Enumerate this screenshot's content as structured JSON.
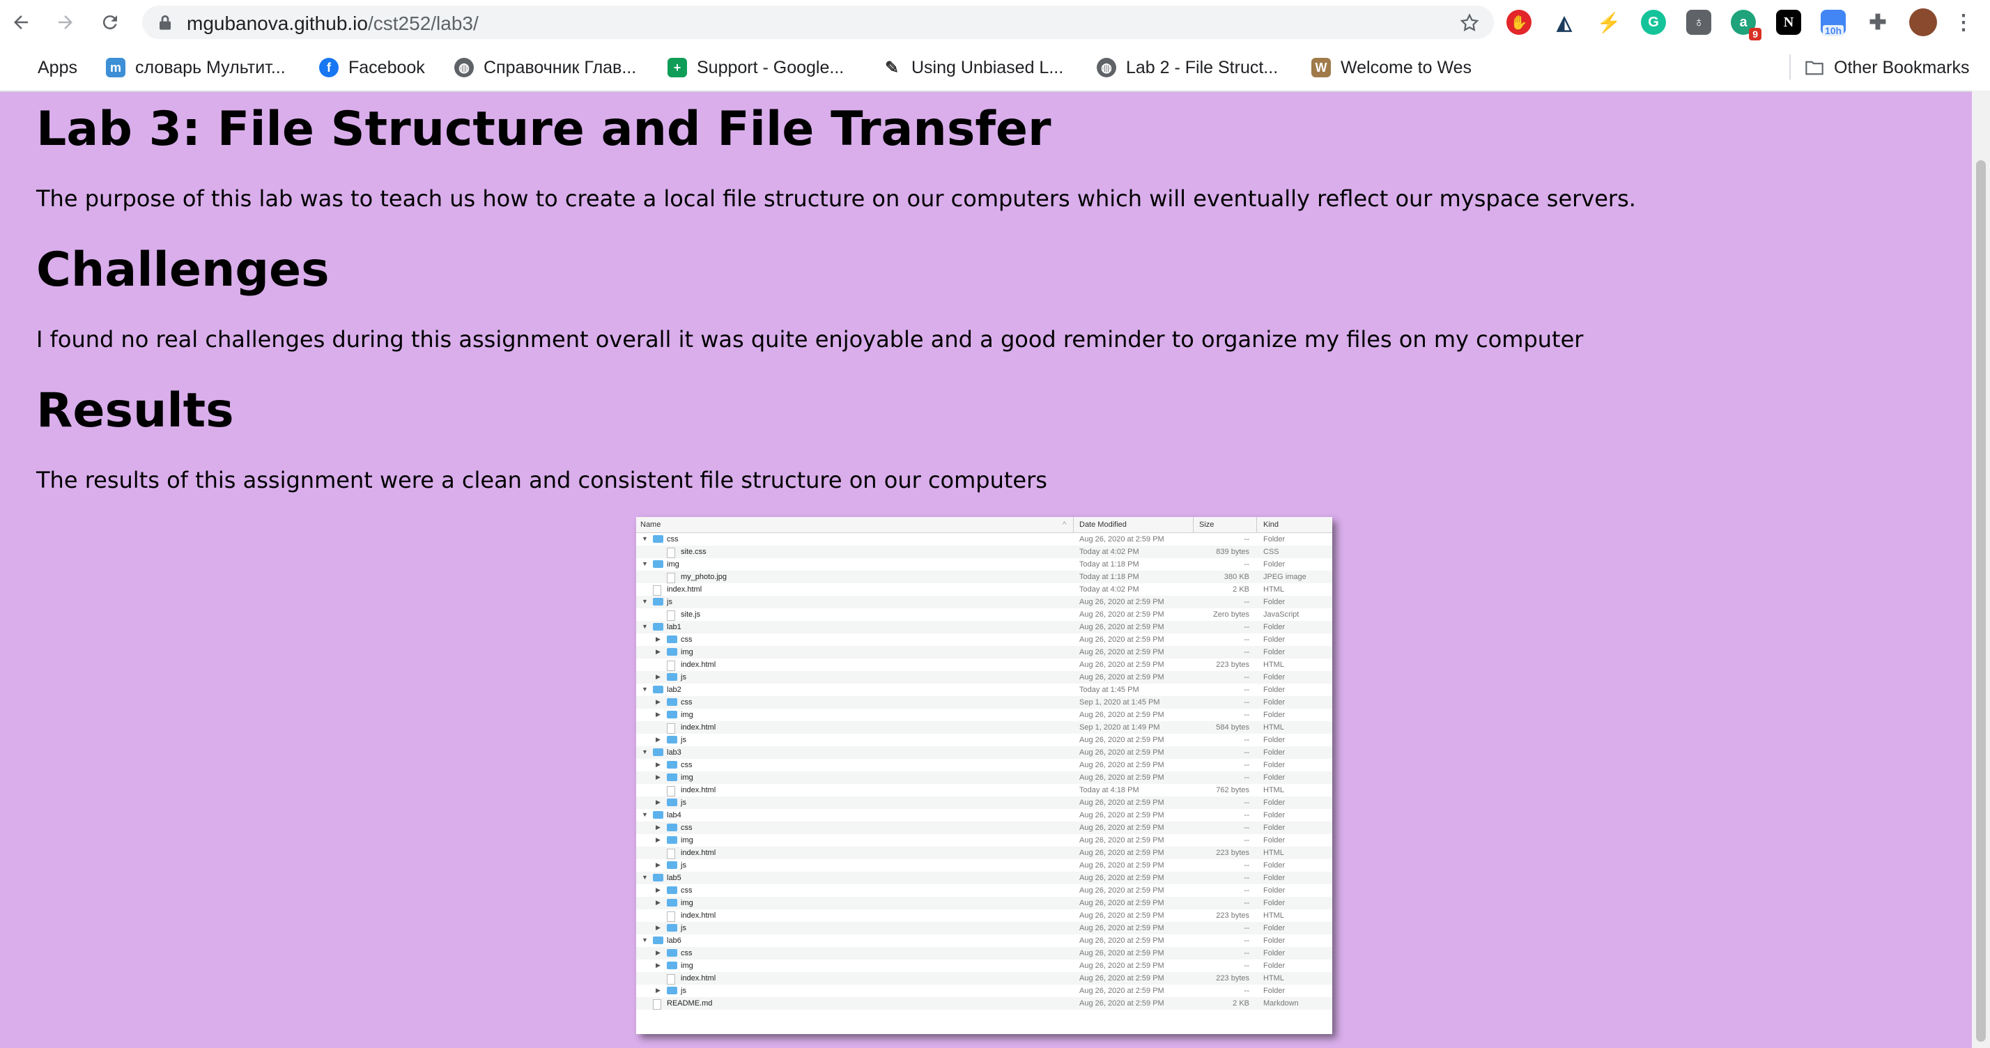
{
  "browser": {
    "url_host": "mgubanova.github.io",
    "url_path": "/cst252/lab3/",
    "extension_badge": "9",
    "timer_label": "10h"
  },
  "bookmarks": {
    "apps": "Apps",
    "items": [
      "словарь Мультит...",
      "Facebook",
      "Справочник Глав...",
      "Support - Google...",
      "Using Unbiased L...",
      "Lab 2 - File Struct...",
      "Welcome to Wes"
    ],
    "other": "Other Bookmarks"
  },
  "page": {
    "title": "Lab 3: File Structure and File Transfer",
    "intro": "The purpose of this lab was to teach us how to create a local file structure on our computers which will eventually reflect our myspace servers.",
    "challenges_heading": "Challenges",
    "challenges_text": "I found no real challenges during this assignment overall it was quite enjoyable and a good reminder to organize my files on my computer",
    "results_heading": "Results",
    "results_text": "The results of this assignment were a clean and consistent file structure on our computers"
  },
  "finder": {
    "columns": [
      "Name",
      "Date Modified",
      "Size",
      "Kind"
    ],
    "rows": [
      {
        "depth": 0,
        "open": true,
        "type": "folder",
        "name": "css",
        "date": "Aug 26, 2020 at 2:59 PM",
        "size": "--",
        "kind": "Folder"
      },
      {
        "depth": 1,
        "open": null,
        "type": "file",
        "name": "site.css",
        "date": "Today at 4:02 PM",
        "size": "839 bytes",
        "kind": "CSS"
      },
      {
        "depth": 0,
        "open": true,
        "type": "folder",
        "name": "img",
        "date": "Today at 1:18 PM",
        "size": "--",
        "kind": "Folder"
      },
      {
        "depth": 1,
        "open": null,
        "type": "file",
        "name": "my_photo.jpg",
        "date": "Today at 1:18 PM",
        "size": "380 KB",
        "kind": "JPEG image"
      },
      {
        "depth": 0,
        "open": null,
        "type": "file",
        "name": "index.html",
        "date": "Today at 4:02 PM",
        "size": "2 KB",
        "kind": "HTML"
      },
      {
        "depth": 0,
        "open": true,
        "type": "folder",
        "name": "js",
        "date": "Aug 26, 2020 at 2:59 PM",
        "size": "--",
        "kind": "Folder"
      },
      {
        "depth": 1,
        "open": null,
        "type": "file",
        "name": "site.js",
        "date": "Aug 26, 2020 at 2:59 PM",
        "size": "Zero bytes",
        "kind": "JavaScript"
      },
      {
        "depth": 0,
        "open": true,
        "type": "folder",
        "name": "lab1",
        "date": "Aug 26, 2020 at 2:59 PM",
        "size": "--",
        "kind": "Folder"
      },
      {
        "depth": 1,
        "open": false,
        "type": "folder",
        "name": "css",
        "date": "Aug 26, 2020 at 2:59 PM",
        "size": "--",
        "kind": "Folder"
      },
      {
        "depth": 1,
        "open": false,
        "type": "folder",
        "name": "img",
        "date": "Aug 26, 2020 at 2:59 PM",
        "size": "--",
        "kind": "Folder"
      },
      {
        "depth": 1,
        "open": null,
        "type": "file",
        "name": "index.html",
        "date": "Aug 26, 2020 at 2:59 PM",
        "size": "223 bytes",
        "kind": "HTML"
      },
      {
        "depth": 1,
        "open": false,
        "type": "folder",
        "name": "js",
        "date": "Aug 26, 2020 at 2:59 PM",
        "size": "--",
        "kind": "Folder"
      },
      {
        "depth": 0,
        "open": true,
        "type": "folder",
        "name": "lab2",
        "date": "Today at 1:45 PM",
        "size": "--",
        "kind": "Folder"
      },
      {
        "depth": 1,
        "open": false,
        "type": "folder",
        "name": "css",
        "date": "Sep 1, 2020 at 1:45 PM",
        "size": "--",
        "kind": "Folder"
      },
      {
        "depth": 1,
        "open": false,
        "type": "folder",
        "name": "img",
        "date": "Aug 26, 2020 at 2:59 PM",
        "size": "--",
        "kind": "Folder"
      },
      {
        "depth": 1,
        "open": null,
        "type": "file",
        "name": "index.html",
        "date": "Sep 1, 2020 at 1:49 PM",
        "size": "584 bytes",
        "kind": "HTML"
      },
      {
        "depth": 1,
        "open": false,
        "type": "folder",
        "name": "js",
        "date": "Aug 26, 2020 at 2:59 PM",
        "size": "--",
        "kind": "Folder"
      },
      {
        "depth": 0,
        "open": true,
        "type": "folder",
        "name": "lab3",
        "date": "Aug 26, 2020 at 2:59 PM",
        "size": "--",
        "kind": "Folder"
      },
      {
        "depth": 1,
        "open": false,
        "type": "folder",
        "name": "css",
        "date": "Aug 26, 2020 at 2:59 PM",
        "size": "--",
        "kind": "Folder"
      },
      {
        "depth": 1,
        "open": false,
        "type": "folder",
        "name": "img",
        "date": "Aug 26, 2020 at 2:59 PM",
        "size": "--",
        "kind": "Folder"
      },
      {
        "depth": 1,
        "open": null,
        "type": "file",
        "name": "index.html",
        "date": "Today at 4:18 PM",
        "size": "762 bytes",
        "kind": "HTML"
      },
      {
        "depth": 1,
        "open": false,
        "type": "folder",
        "name": "js",
        "date": "Aug 26, 2020 at 2:59 PM",
        "size": "--",
        "kind": "Folder"
      },
      {
        "depth": 0,
        "open": true,
        "type": "folder",
        "name": "lab4",
        "date": "Aug 26, 2020 at 2:59 PM",
        "size": "--",
        "kind": "Folder"
      },
      {
        "depth": 1,
        "open": false,
        "type": "folder",
        "name": "css",
        "date": "Aug 26, 2020 at 2:59 PM",
        "size": "--",
        "kind": "Folder"
      },
      {
        "depth": 1,
        "open": false,
        "type": "folder",
        "name": "img",
        "date": "Aug 26, 2020 at 2:59 PM",
        "size": "--",
        "kind": "Folder"
      },
      {
        "depth": 1,
        "open": null,
        "type": "file",
        "name": "index.html",
        "date": "Aug 26, 2020 at 2:59 PM",
        "size": "223 bytes",
        "kind": "HTML"
      },
      {
        "depth": 1,
        "open": false,
        "type": "folder",
        "name": "js",
        "date": "Aug 26, 2020 at 2:59 PM",
        "size": "--",
        "kind": "Folder"
      },
      {
        "depth": 0,
        "open": true,
        "type": "folder",
        "name": "lab5",
        "date": "Aug 26, 2020 at 2:59 PM",
        "size": "--",
        "kind": "Folder"
      },
      {
        "depth": 1,
        "open": false,
        "type": "folder",
        "name": "css",
        "date": "Aug 26, 2020 at 2:59 PM",
        "size": "--",
        "kind": "Folder"
      },
      {
        "depth": 1,
        "open": false,
        "type": "folder",
        "name": "img",
        "date": "Aug 26, 2020 at 2:59 PM",
        "size": "--",
        "kind": "Folder"
      },
      {
        "depth": 1,
        "open": null,
        "type": "file",
        "name": "index.html",
        "date": "Aug 26, 2020 at 2:59 PM",
        "size": "223 bytes",
        "kind": "HTML"
      },
      {
        "depth": 1,
        "open": false,
        "type": "folder",
        "name": "js",
        "date": "Aug 26, 2020 at 2:59 PM",
        "size": "--",
        "kind": "Folder"
      },
      {
        "depth": 0,
        "open": true,
        "type": "folder",
        "name": "lab6",
        "date": "Aug 26, 2020 at 2:59 PM",
        "size": "--",
        "kind": "Folder"
      },
      {
        "depth": 1,
        "open": false,
        "type": "folder",
        "name": "css",
        "date": "Aug 26, 2020 at 2:59 PM",
        "size": "--",
        "kind": "Folder"
      },
      {
        "depth": 1,
        "open": false,
        "type": "folder",
        "name": "img",
        "date": "Aug 26, 2020 at 2:59 PM",
        "size": "--",
        "kind": "Folder"
      },
      {
        "depth": 1,
        "open": null,
        "type": "file",
        "name": "index.html",
        "date": "Aug 26, 2020 at 2:59 PM",
        "size": "223 bytes",
        "kind": "HTML"
      },
      {
        "depth": 1,
        "open": false,
        "type": "folder",
        "name": "js",
        "date": "Aug 26, 2020 at 2:59 PM",
        "size": "--",
        "kind": "Folder"
      },
      {
        "depth": 0,
        "open": null,
        "type": "file",
        "name": "README.md",
        "date": "Aug 26, 2020 at 2:59 PM",
        "size": "2 KB",
        "kind": "Markdown"
      }
    ]
  }
}
